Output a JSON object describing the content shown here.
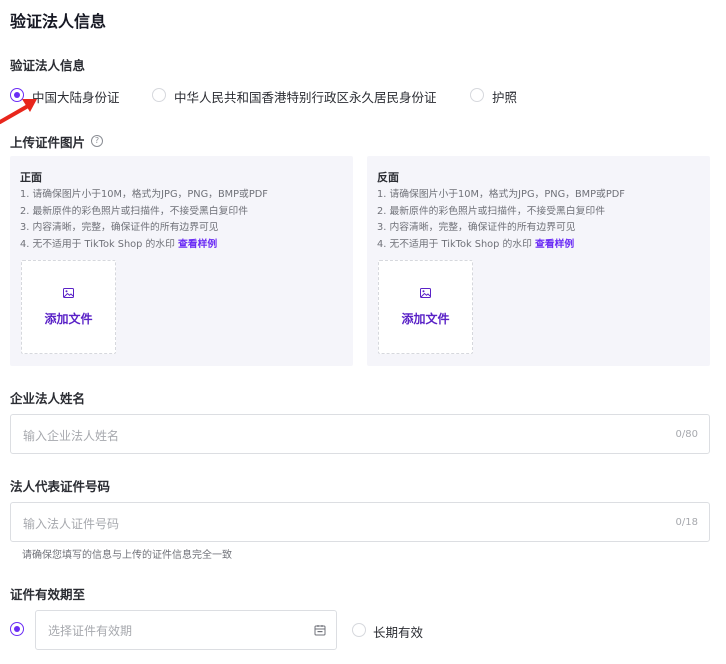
{
  "page": {
    "title": "验证法人信息"
  },
  "id_type": {
    "label": "验证法人信息",
    "options": [
      {
        "label": "中国大陆身份证",
        "checked": true
      },
      {
        "label": "中华人民共和国香港特别行政区永久居民身份证",
        "checked": false
      },
      {
        "label": "护照",
        "checked": false
      }
    ]
  },
  "upload": {
    "label": "上传证件图片",
    "help_icon": "question-circle-icon",
    "front": {
      "title": "正面",
      "rules": [
        "1. 请确保图片小于10M，格式为JPG，PNG，BMP或PDF",
        "2. 最新原件的彩色照片或扫描件，不接受黑白复印件",
        "3. 内容清晰，完整，确保证件的所有边界可见",
        "4. 无不适用于 TikTok Shop 的水印"
      ],
      "sample_link": "查看样例",
      "button_label": "添加文件",
      "icon": "image-icon"
    },
    "back": {
      "title": "反面",
      "rules": [
        "1. 请确保图片小于10M，格式为JPG，PNG，BMP或PDF",
        "2. 最新原件的彩色照片或扫描件，不接受黑白复印件",
        "3. 内容清晰，完整，确保证件的所有边界可见",
        "4. 无不适用于 TikTok Shop 的水印"
      ],
      "sample_link": "查看样例",
      "button_label": "添加文件",
      "icon": "image-icon"
    }
  },
  "legal_name": {
    "label": "企业法人姓名",
    "placeholder": "输入企业法人姓名",
    "value": "",
    "counter": "0/80"
  },
  "id_number": {
    "label": "法人代表证件号码",
    "placeholder": "输入法人证件号码",
    "value": "",
    "counter": "0/18",
    "hint": "请确保您填写的信息与上传的证件信息完全一致"
  },
  "validity": {
    "label": "证件有效期至",
    "date_placeholder": "选择证件有效期",
    "date_icon": "calendar-icon",
    "date_checked": true,
    "long_term_label": "长期有效",
    "long_term_checked": false
  },
  "colors": {
    "accent": "#6b2cf5",
    "annotation_arrow": "#e8261c",
    "panel_bg": "#f5f5fa"
  },
  "annotation": {
    "icon": "red-arrow-icon"
  }
}
